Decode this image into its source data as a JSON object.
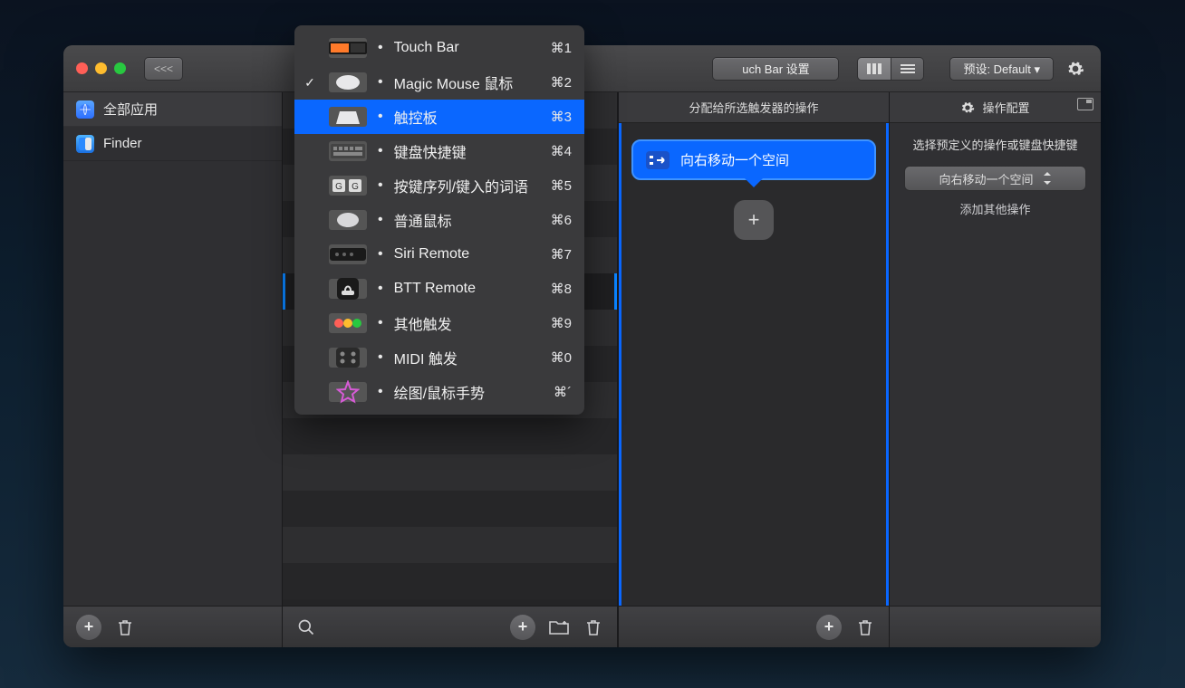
{
  "toolbar": {
    "back_label": "<<<",
    "tab_partial": "uch Bar 设置",
    "preset_label": "预设: Default ▾"
  },
  "sidebar": {
    "items": [
      {
        "label": "全部应用",
        "icon": "globe"
      },
      {
        "label": "Finder",
        "icon": "finder"
      }
    ]
  },
  "actions": {
    "header": "分配给所选触发器的操作",
    "card_label": "向右移动一个空间"
  },
  "config": {
    "header": "操作配置",
    "subhead": "选择预定义的操作或键盘快捷键",
    "select_value": "向右移动一个空间",
    "add_more": "添加其他操作"
  },
  "dropdown": {
    "items": [
      {
        "label": "Touch Bar",
        "shortcut": "⌘1",
        "icon": "touchbar",
        "checked": false
      },
      {
        "label": "Magic Mouse 鼠标",
        "shortcut": "⌘2",
        "icon": "mouse",
        "checked": true
      },
      {
        "label": "触控板",
        "shortcut": "⌘3",
        "icon": "trackpad",
        "checked": false,
        "selected": true
      },
      {
        "label": "键盘快捷键",
        "shortcut": "⌘4",
        "icon": "keyboard",
        "checked": false
      },
      {
        "label": "按键序列/键入的词语",
        "shortcut": "⌘5",
        "icon": "keys",
        "checked": false
      },
      {
        "label": "普通鼠标",
        "shortcut": "⌘6",
        "icon": "mouse2",
        "checked": false
      },
      {
        "label": "Siri Remote",
        "shortcut": "⌘7",
        "icon": "remote",
        "checked": false
      },
      {
        "label": "BTT Remote",
        "shortcut": "⌘8",
        "icon": "btt",
        "checked": false
      },
      {
        "label": "其他触发",
        "shortcut": "⌘9",
        "icon": "dots",
        "checked": false
      },
      {
        "label": "MIDI 触发",
        "shortcut": "⌘0",
        "icon": "midi",
        "checked": false
      },
      {
        "label": "绘图/鼠标手势",
        "shortcut": "⌘´",
        "icon": "draw",
        "checked": false
      }
    ]
  }
}
